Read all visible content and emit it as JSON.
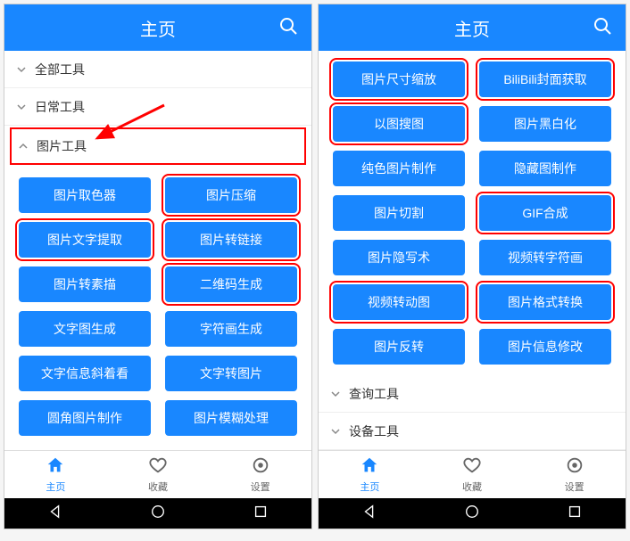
{
  "header": {
    "title": "主页"
  },
  "left": {
    "categories": [
      {
        "label": "全部工具",
        "expanded": false
      },
      {
        "label": "日常工具",
        "expanded": false
      },
      {
        "label": "图片工具",
        "expanded": true,
        "highlighted": true
      }
    ],
    "tools": [
      {
        "label": "图片取色器",
        "red": false
      },
      {
        "label": "图片压缩",
        "red": true
      },
      {
        "label": "图片文字提取",
        "red": true
      },
      {
        "label": "图片转链接",
        "red": true
      },
      {
        "label": "图片转素描",
        "red": false
      },
      {
        "label": "二维码生成",
        "red": true
      },
      {
        "label": "文字图生成",
        "red": false
      },
      {
        "label": "字符画生成",
        "red": false
      },
      {
        "label": "文字信息斜着看",
        "red": false
      },
      {
        "label": "文字转图片",
        "red": false
      },
      {
        "label": "圆角图片制作",
        "red": false
      },
      {
        "label": "图片模糊处理",
        "red": false
      }
    ]
  },
  "right": {
    "tools": [
      {
        "label": "图片尺寸缩放",
        "red": true
      },
      {
        "label": "BiliBili封面获取",
        "red": true
      },
      {
        "label": "以图搜图",
        "red": true
      },
      {
        "label": "图片黑白化",
        "red": false
      },
      {
        "label": "纯色图片制作",
        "red": false
      },
      {
        "label": "隐藏图制作",
        "red": false
      },
      {
        "label": "图片切割",
        "red": false
      },
      {
        "label": "GIF合成",
        "red": true
      },
      {
        "label": "图片隐写术",
        "red": false
      },
      {
        "label": "视频转字符画",
        "red": false
      },
      {
        "label": "视频转动图",
        "red": true
      },
      {
        "label": "图片格式转换",
        "red": true
      },
      {
        "label": "图片反转",
        "red": false
      },
      {
        "label": "图片信息修改",
        "red": false
      }
    ],
    "categories_after": [
      {
        "label": "查询工具"
      },
      {
        "label": "设备工具"
      }
    ]
  },
  "tabs": [
    {
      "label": "主页",
      "icon": "home",
      "active": true
    },
    {
      "label": "收藏",
      "icon": "heart",
      "active": false
    },
    {
      "label": "设置",
      "icon": "gear",
      "active": false
    }
  ]
}
